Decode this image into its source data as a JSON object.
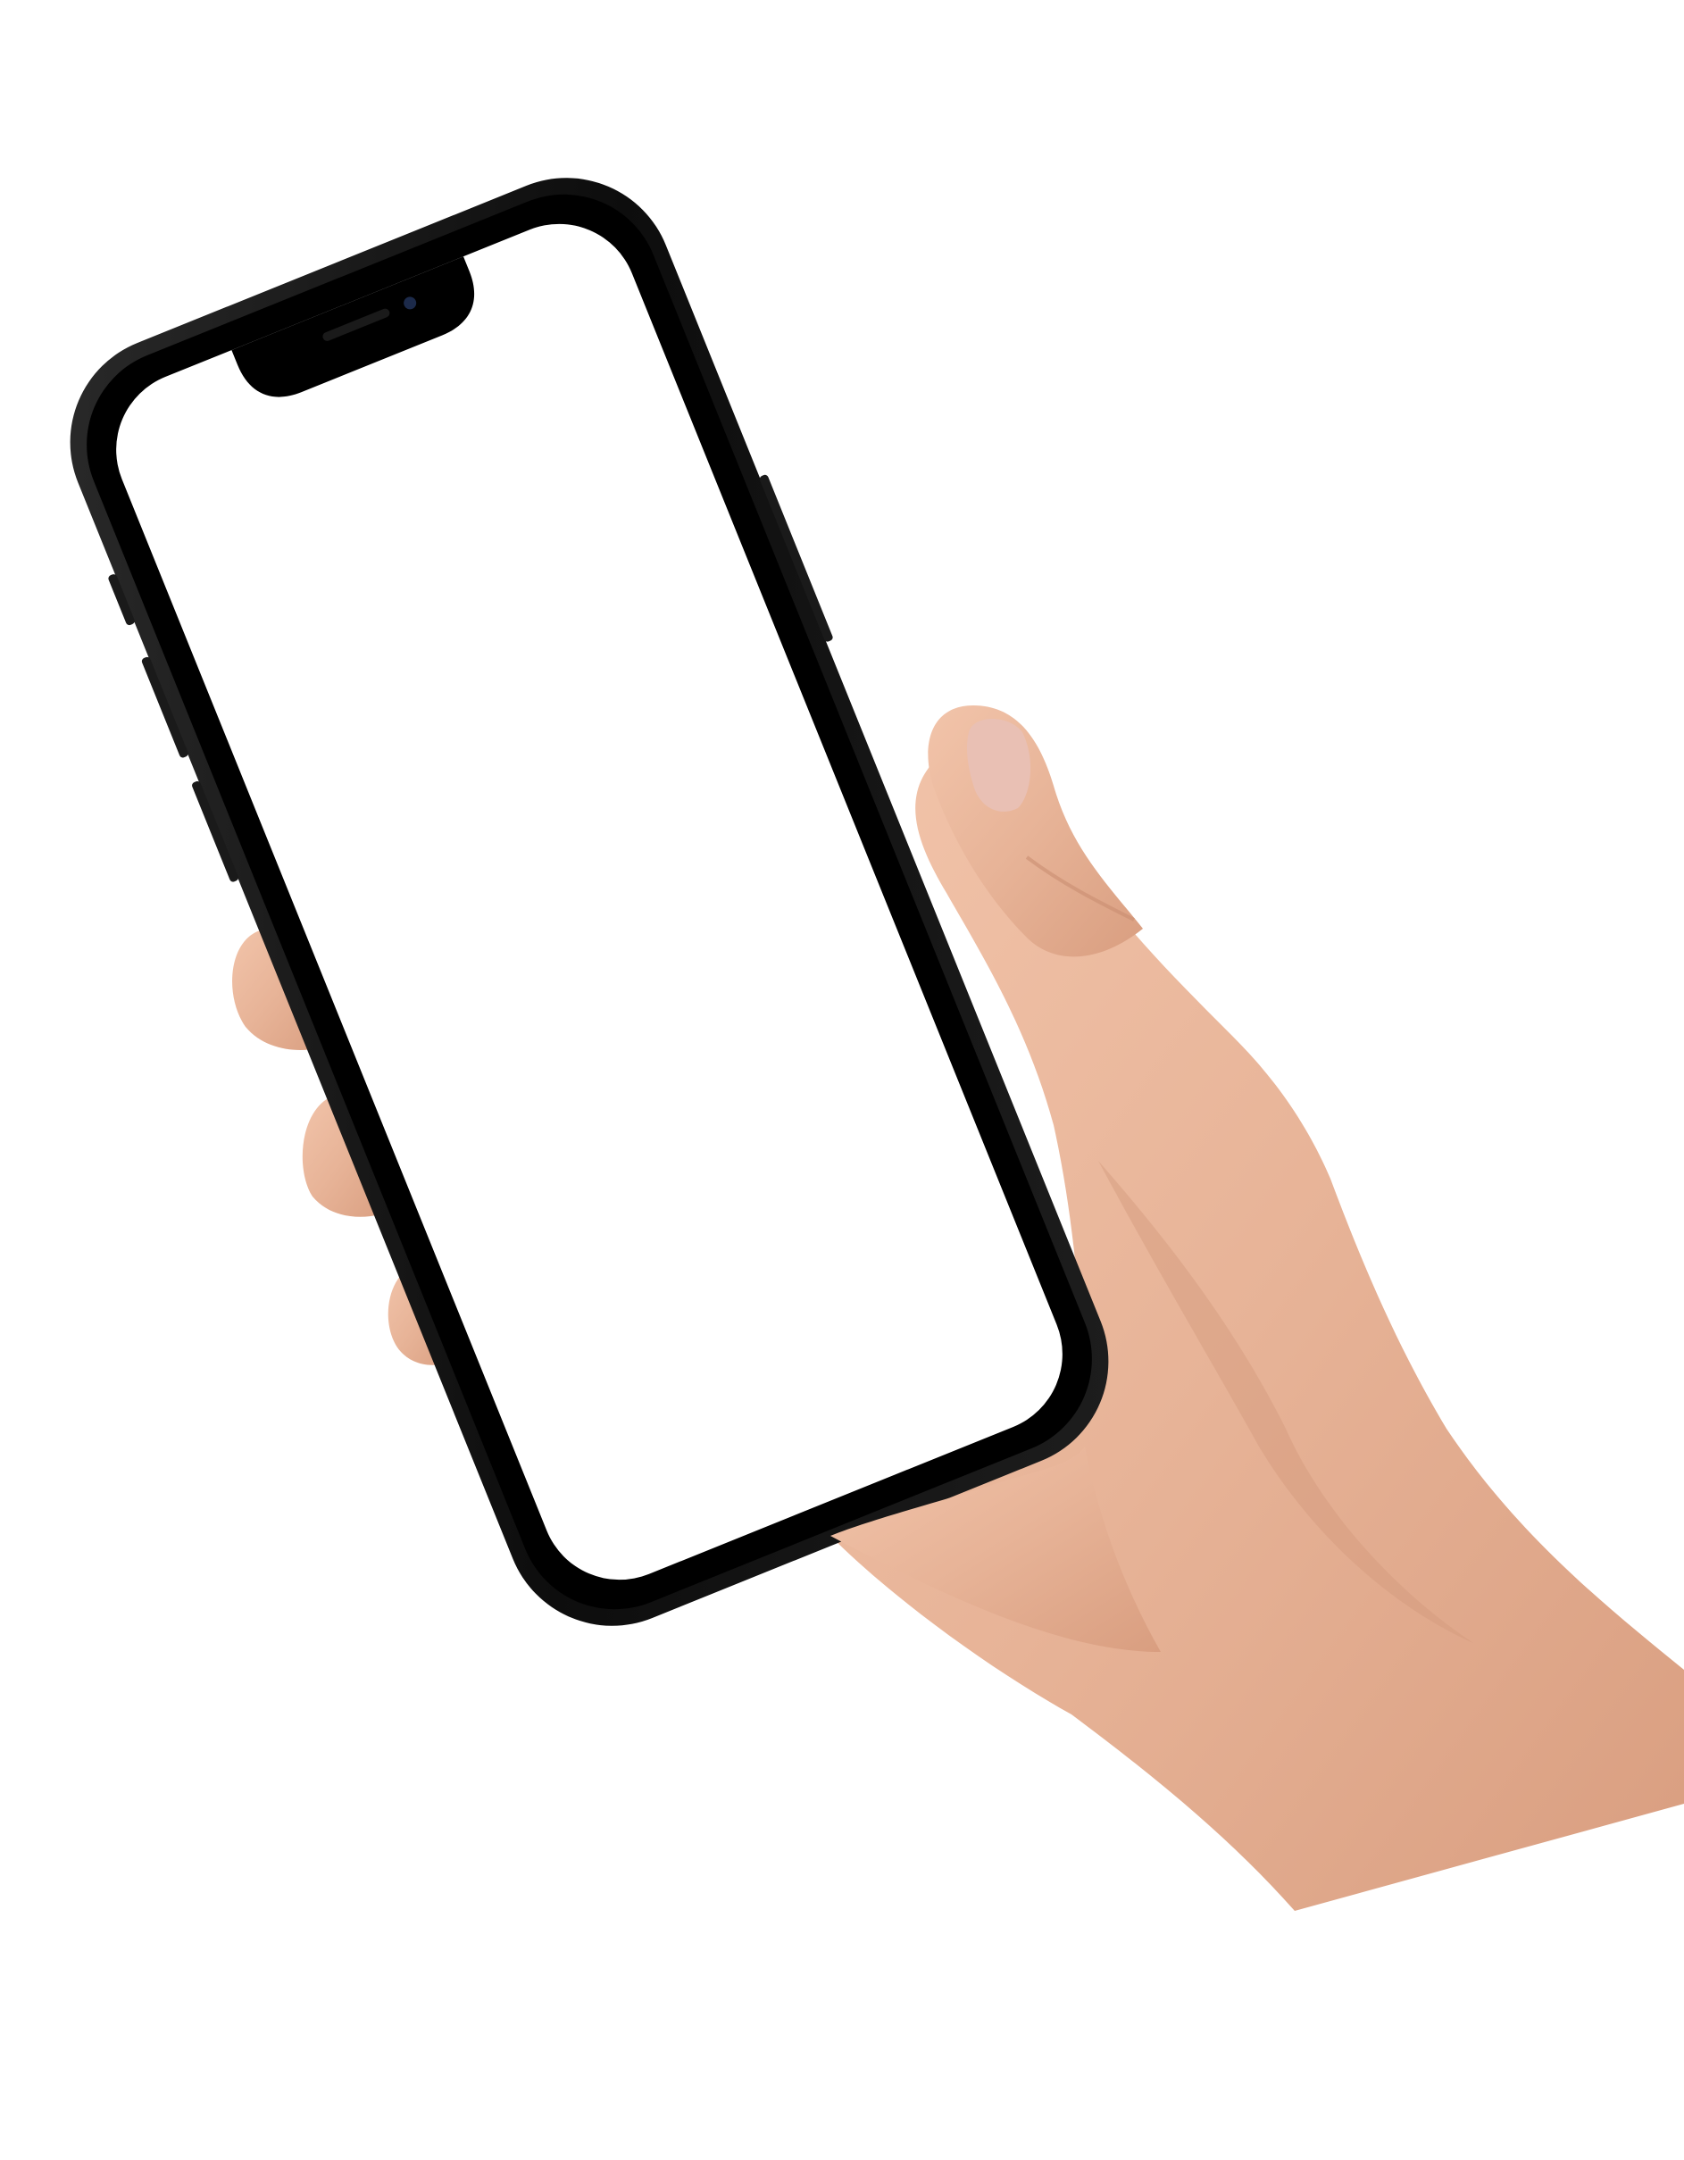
{
  "scene": {
    "background_color": "#ffffff",
    "subject": "hand-holding-smartphone",
    "phone": {
      "frame_color": "#0d0d0d",
      "bezel_color": "#000000",
      "screen_color": "#ffffff",
      "screen_content": "blank",
      "has_notch": true,
      "camera_color": "#1c2a4a"
    },
    "hand": {
      "skin_color": "#e7b397",
      "shadow_color": "#c98e72",
      "nail_color": "#e9c0b4"
    }
  }
}
